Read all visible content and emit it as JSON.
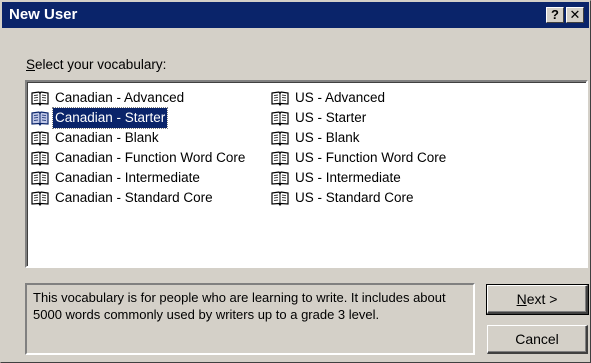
{
  "window": {
    "title": "New User",
    "help_label": "?",
    "close_label": "✕"
  },
  "caption": {
    "accel": "S",
    "rest": "elect your vocabulary:"
  },
  "vocabularies": {
    "left": [
      {
        "label": "Canadian - Advanced",
        "selected": false,
        "icon": "book-icon"
      },
      {
        "label": "Canadian - Starter",
        "selected": true,
        "icon": "book-icon"
      },
      {
        "label": "Canadian - Blank",
        "selected": false,
        "icon": "book-icon"
      },
      {
        "label": "Canadian - Function Word Core",
        "selected": false,
        "icon": "book-icon"
      },
      {
        "label": "Canadian - Intermediate",
        "selected": false,
        "icon": "book-icon"
      },
      {
        "label": "Canadian - Standard Core",
        "selected": false,
        "icon": "book-icon"
      }
    ],
    "right": [
      {
        "label": "US - Advanced",
        "selected": false,
        "icon": "book-icon"
      },
      {
        "label": "US - Starter",
        "selected": false,
        "icon": "book-icon"
      },
      {
        "label": "US - Blank",
        "selected": false,
        "icon": "book-icon"
      },
      {
        "label": "US - Function Word Core",
        "selected": false,
        "icon": "book-icon"
      },
      {
        "label": "US - Intermediate",
        "selected": false,
        "icon": "book-icon"
      },
      {
        "label": "US - Standard Core",
        "selected": false,
        "icon": "book-icon"
      }
    ]
  },
  "description": "This vocabulary is for people who are learning to write.  It includes about 5000 words commonly used by writers up to a grade 3 level.",
  "buttons": {
    "next_accel": "N",
    "next_rest": "ext >",
    "cancel": "Cancel"
  },
  "colors": {
    "titlebar": "#0a246a",
    "face": "#d4d0c8",
    "selection": "#0a246a"
  }
}
